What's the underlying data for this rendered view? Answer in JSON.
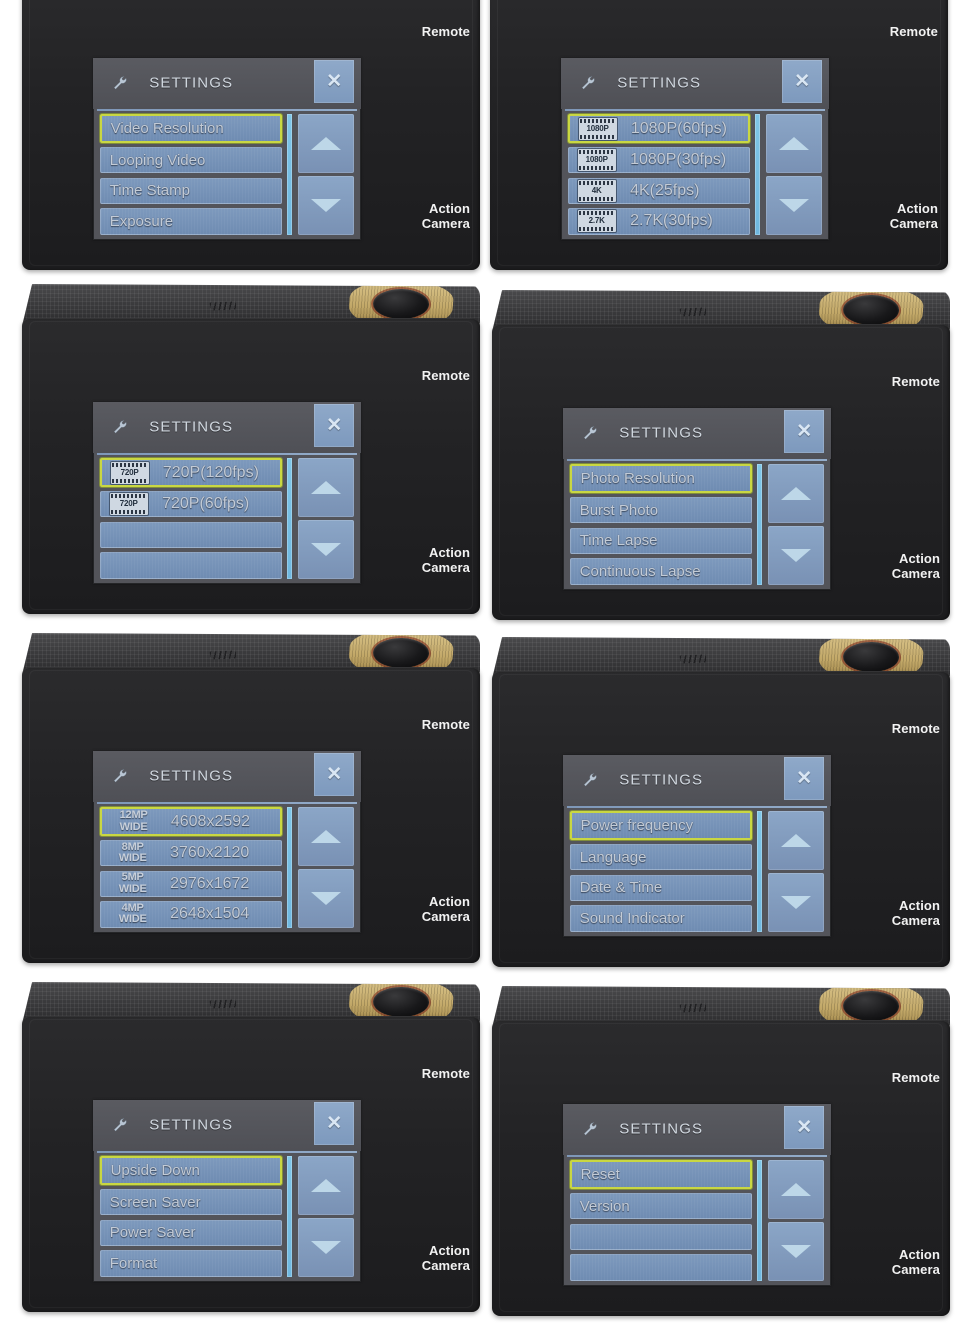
{
  "device": {
    "label_remote": "Remote",
    "label_action": "Action",
    "label_camera": "Camera",
    "icon_shutter": "shutter-button",
    "icon_mic": "microphone-slits"
  },
  "screen": {
    "title": "SETTINGS",
    "wrench_icon": "wrench-icon",
    "close_label": "✕",
    "scroll_up_icon": "triangle-up-icon",
    "scroll_down_icon": "triangle-down-icon"
  },
  "colors": {
    "selection_border": "#c9d742",
    "row_fill": "#7d99bd",
    "screen_bg": "#53545a",
    "header_bg": "#55565c",
    "scrollbar": "#7fc6e8",
    "body_black": "#232325",
    "accent_gold": "#c2a868"
  },
  "panels": [
    {
      "id": "video-menu",
      "cropped_top": true,
      "rows": [
        {
          "label": "Video Resolution",
          "selected": true,
          "icon": null
        },
        {
          "label": "Looping Video",
          "selected": false,
          "icon": null
        },
        {
          "label": "Time Stamp",
          "selected": false,
          "icon": null
        },
        {
          "label": "Exposure",
          "selected": false,
          "icon": null
        }
      ]
    },
    {
      "id": "video-resolution-1",
      "cropped_top": true,
      "rows": [
        {
          "label": "1080P(60fps)",
          "selected": true,
          "icon": "film",
          "icon_text": "1080P"
        },
        {
          "label": "1080P(30fps)",
          "selected": false,
          "icon": "film",
          "icon_text": "1080P"
        },
        {
          "label": "4K(25fps)",
          "selected": false,
          "icon": "film",
          "icon_text": "4K"
        },
        {
          "label": "2.7K(30fps)",
          "selected": false,
          "icon": "film",
          "icon_text": "2.7K"
        }
      ]
    },
    {
      "id": "video-resolution-2",
      "cropped_top": false,
      "rows": [
        {
          "label": "720P(120fps)",
          "selected": true,
          "icon": "film",
          "icon_text": "720P"
        },
        {
          "label": "720P(60fps)",
          "selected": false,
          "icon": "film",
          "icon_text": "720P"
        },
        {
          "label": "",
          "selected": false,
          "icon": null,
          "empty": true
        },
        {
          "label": "",
          "selected": false,
          "icon": null,
          "empty": true
        }
      ]
    },
    {
      "id": "photo-menu",
      "cropped_top": false,
      "rows": [
        {
          "label": "Photo Resolution",
          "selected": true,
          "icon": null
        },
        {
          "label": "Burst Photo",
          "selected": false,
          "icon": null
        },
        {
          "label": "Time Lapse",
          "selected": false,
          "icon": null
        },
        {
          "label": "Continuous Lapse",
          "selected": false,
          "icon": null
        }
      ]
    },
    {
      "id": "photo-resolution",
      "cropped_top": false,
      "rows": [
        {
          "label": "4608x2592",
          "selected": true,
          "icon": "mp",
          "icon_text": "12MP",
          "icon_text2": "WIDE"
        },
        {
          "label": "3760x2120",
          "selected": false,
          "icon": "mp",
          "icon_text": "8MP",
          "icon_text2": "WIDE"
        },
        {
          "label": "2976x1672",
          "selected": false,
          "icon": "mp",
          "icon_text": "5MP",
          "icon_text2": "WIDE"
        },
        {
          "label": "2648x1504",
          "selected": false,
          "icon": "mp",
          "icon_text": "4MP",
          "icon_text2": "WIDE"
        }
      ]
    },
    {
      "id": "system-menu-1",
      "cropped_top": false,
      "rows": [
        {
          "label": "Power frequency",
          "selected": true,
          "icon": null
        },
        {
          "label": "Language",
          "selected": false,
          "icon": null
        },
        {
          "label": "Date & Time",
          "selected": false,
          "icon": null
        },
        {
          "label": "Sound Indicator",
          "selected": false,
          "icon": null
        }
      ]
    },
    {
      "id": "system-menu-2",
      "cropped_top": false,
      "rows": [
        {
          "label": "Upside Down",
          "selected": true,
          "icon": null
        },
        {
          "label": "Screen Saver",
          "selected": false,
          "icon": null
        },
        {
          "label": "Power Saver",
          "selected": false,
          "icon": null
        },
        {
          "label": "Format",
          "selected": false,
          "icon": null
        }
      ]
    },
    {
      "id": "system-menu-3",
      "cropped_top": false,
      "rows": [
        {
          "label": "Reset",
          "selected": true,
          "icon": null
        },
        {
          "label": "Version",
          "selected": false,
          "icon": null
        },
        {
          "label": "",
          "selected": false,
          "icon": null,
          "empty": true
        },
        {
          "label": "",
          "selected": false,
          "icon": null,
          "empty": true
        }
      ]
    }
  ]
}
